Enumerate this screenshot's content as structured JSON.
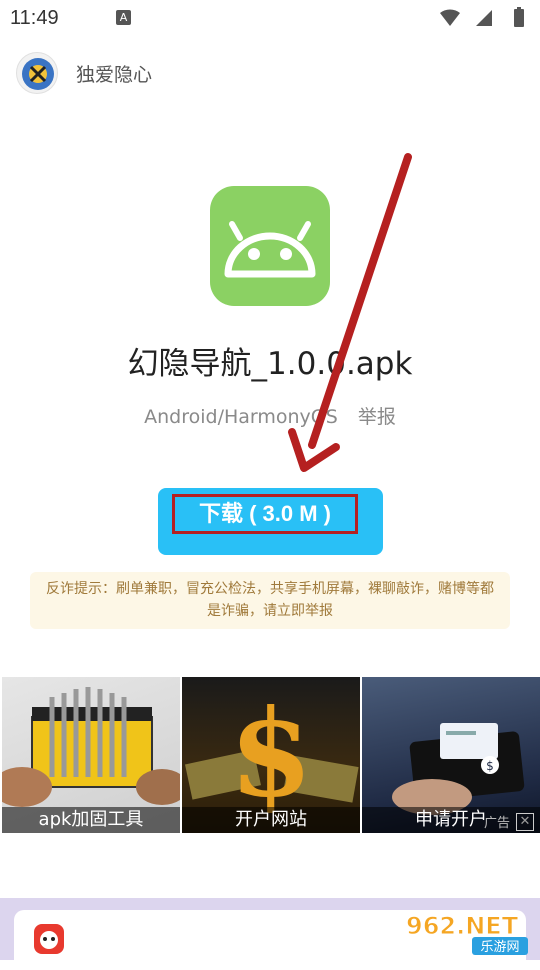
{
  "status_bar": {
    "time": "11:49",
    "notification_glyph": "A",
    "icons": [
      "wifi-icon",
      "signal-icon",
      "battery-icon"
    ]
  },
  "header": {
    "owner_name": "独爱隐心"
  },
  "app": {
    "name": "幻隐导航_1.0.0.apk",
    "platform": "Android/HarmonyOS",
    "report_label": "举报",
    "icon_color": "#8bd163"
  },
  "download": {
    "label": "下载 ( 3.0 M )",
    "color": "#29c0f6"
  },
  "notice": {
    "text": "反诈提示：刷单兼职，冒充公检法，共享手机屏幕，裸聊敲诈，赌博等都是诈骗，请立即举报"
  },
  "banners": [
    {
      "caption": "apk加固工具"
    },
    {
      "caption": "开户网站"
    },
    {
      "caption": "申请开户"
    }
  ],
  "ad": {
    "label": "广告",
    "close": "✕"
  },
  "watermark": {
    "top": "962.NET",
    "bottom": "乐游网"
  }
}
